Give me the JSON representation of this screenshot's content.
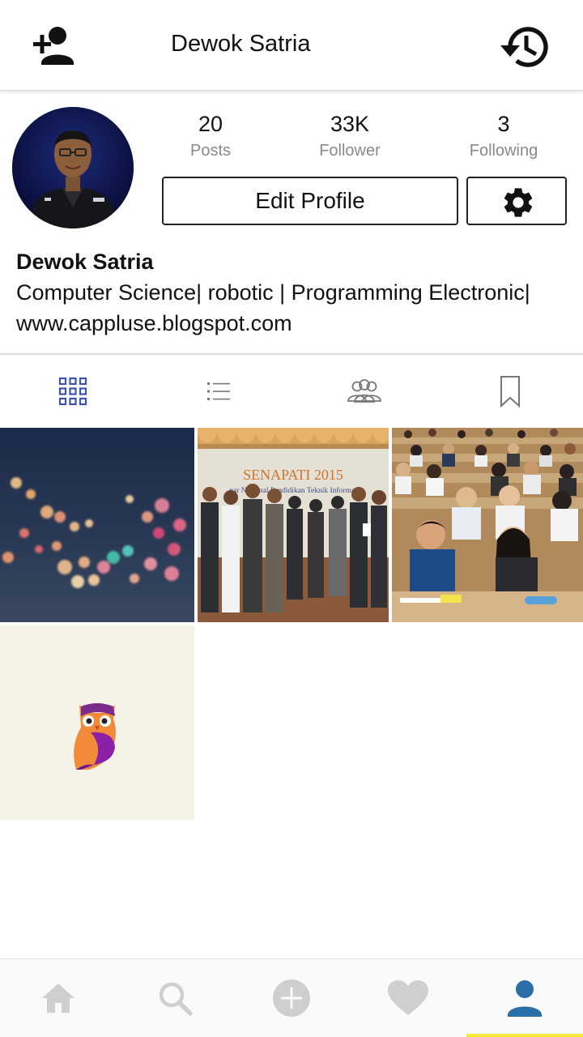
{
  "header": {
    "title": "Dewok Satria",
    "add_user_icon": "person-add-icon",
    "history_icon": "history-icon"
  },
  "profile": {
    "stats": [
      {
        "value": "20",
        "label": "Posts"
      },
      {
        "value": "33K",
        "label": "Follower"
      },
      {
        "value": "3",
        "label": "Following"
      }
    ],
    "edit_profile_label": "Edit Profile",
    "settings_icon": "gear-icon",
    "name": "Dewok Satria",
    "bio_line1": "Computer Science| robotic | Programming Electronic|",
    "bio_line2": "www.cappluse.blogspot.com"
  },
  "view_tabs": [
    {
      "icon": "grid-icon",
      "active": true
    },
    {
      "icon": "list-icon",
      "active": false
    },
    {
      "icon": "people-tag-icon",
      "active": false
    },
    {
      "icon": "bookmark-icon",
      "active": false
    }
  ],
  "posts": [
    {
      "subject": "city bokeh lights"
    },
    {
      "subject": "SENAPATI 2015 group photo",
      "caption_line1": "SENAPATI 2015",
      "caption_line2": "nar Nasional Pendidikan Teknik Informat"
    },
    {
      "subject": "lecture hall students"
    },
    {
      "subject": "owl logo"
    }
  ],
  "bottom_nav": [
    {
      "icon": "home-icon",
      "active": false
    },
    {
      "icon": "search-icon",
      "active": false
    },
    {
      "icon": "add-circle-icon",
      "active": false
    },
    {
      "icon": "heart-icon",
      "active": false
    },
    {
      "icon": "profile-icon",
      "active": true
    }
  ],
  "colors": {
    "accent_blue": "#2b6ea8",
    "tab_active": "#3f51b5",
    "inactive_icon": "#cfcfcf",
    "active_underline": "#f5e93a"
  }
}
